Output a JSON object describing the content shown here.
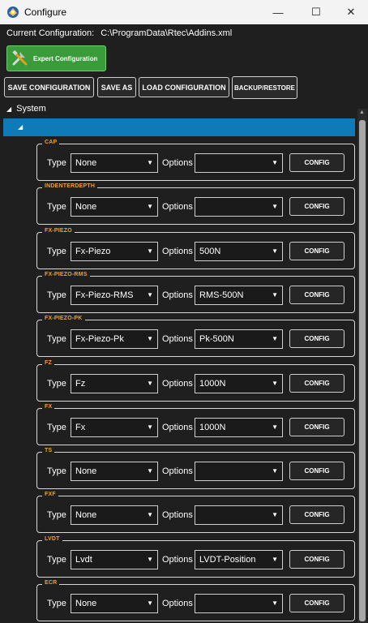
{
  "window": {
    "title": "Configure",
    "minimize": "—",
    "maximize": "☐",
    "close": "✕"
  },
  "header": {
    "current_label": "Current Configuration:",
    "current_path": "C:\\ProgramData\\Rtec\\Addins.xml"
  },
  "toolbar": {
    "expert_label": "Expert Configuration",
    "save_config": "SAVE CONFIGURATION",
    "save_as": "SAVE AS",
    "load_config": "LOAD CONFIGURATION",
    "backup_restore": "BACKUP/RESTORE"
  },
  "tree": {
    "root_label": "System",
    "expand_glyph": "◢"
  },
  "labels": {
    "type": "Type",
    "options": "Options",
    "config": "CONFIG",
    "caret": "▼"
  },
  "groups": [
    {
      "title": "CAP",
      "type": "None",
      "option": ""
    },
    {
      "title": "INDENTERDEPTH",
      "type": "None",
      "option": ""
    },
    {
      "title": "FX-PIEZO",
      "type": "Fx-Piezo",
      "option": "500N"
    },
    {
      "title": "FX-PIEZO-RMS",
      "type": "Fx-Piezo-RMS",
      "option": "RMS-500N"
    },
    {
      "title": "FX-PIEZO-PK",
      "type": "Fx-Piezo-Pk",
      "option": "Pk-500N"
    },
    {
      "title": "FZ",
      "type": "Fz",
      "option": "1000N"
    },
    {
      "title": "FX",
      "type": "Fx",
      "option": "1000N"
    },
    {
      "title": "TS",
      "type": "None",
      "option": ""
    },
    {
      "title": "FXF",
      "type": "None",
      "option": ""
    },
    {
      "title": "LVDT",
      "type": "Lvdt",
      "option": "LVDT-Position"
    },
    {
      "title": "ECR",
      "type": "None",
      "option": ""
    }
  ],
  "colors": {
    "accent": "#0e7ab8",
    "group_title": "#f0a030",
    "expert_bg": "#3a9b3a"
  }
}
